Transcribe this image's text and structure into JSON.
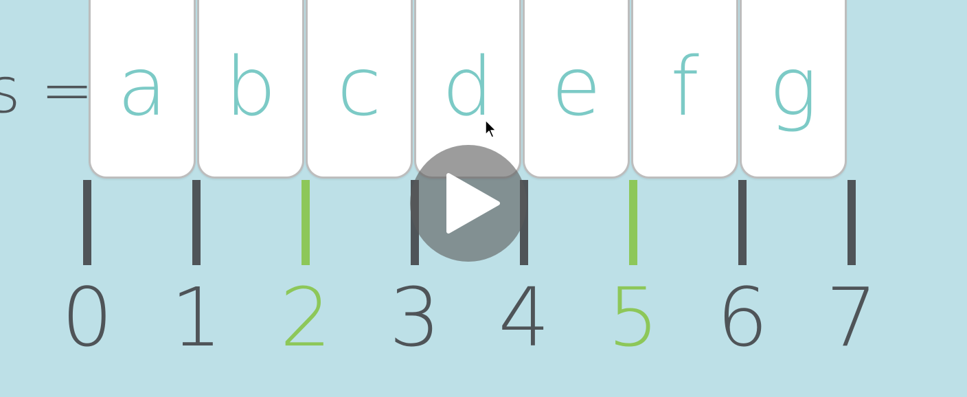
{
  "video": {
    "variable_label": "s =",
    "cells": [
      "a",
      "b",
      "c",
      "d",
      "e",
      "f",
      "g"
    ],
    "indices": [
      "0",
      "1",
      "2",
      "3",
      "4",
      "5",
      "6",
      "7"
    ],
    "highlighted_indices": [
      2,
      5
    ]
  },
  "controls": {
    "play_icon": "play-icon",
    "cursor_icon": "mouse-pointer-icon"
  },
  "colors": {
    "background": "#bde0e7",
    "cell_text": "#7ccac6",
    "tick_default": "#4f5458",
    "tick_highlight": "#8dc759",
    "label_text": "#4f5458"
  }
}
